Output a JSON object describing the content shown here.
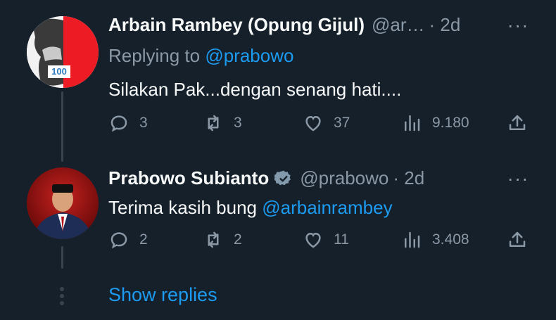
{
  "tweets": [
    {
      "display_name": "Arbain Rambey (Opung Gijul)",
      "handle": "@ar…",
      "time": "· 2d",
      "replying_prefix": "Replying to",
      "replying_handle": "@prabowo",
      "text": "Silakan Pak...dengan senang hati....",
      "avatar_badge": "100",
      "stats": {
        "replies": "3",
        "retweets": "3",
        "likes": "37",
        "views": "9.180"
      }
    },
    {
      "display_name": "Prabowo Subianto",
      "handle": "@prabowo",
      "time": "· 2d",
      "text": "Terima kasih bung",
      "mention": "@arbainrambey",
      "stats": {
        "replies": "2",
        "retweets": "2",
        "likes": "11",
        "views": "3.408"
      }
    }
  ],
  "show_replies": "Show replies",
  "more_glyph": "···",
  "colors": {
    "background": "#15202b",
    "link": "#1d9bf0",
    "muted": "#8b98a5",
    "verified": "#829aab"
  }
}
